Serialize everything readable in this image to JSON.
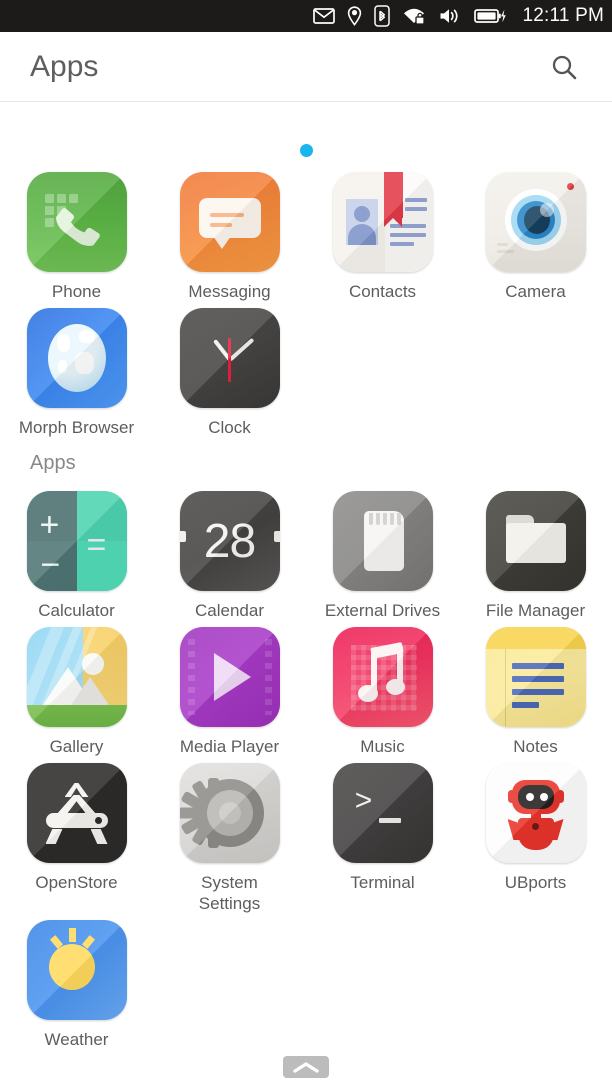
{
  "statusbar": {
    "time": "12:11 PM",
    "icons": [
      {
        "name": "message-icon",
        "label": "Messages"
      },
      {
        "name": "location-icon",
        "label": "Location"
      },
      {
        "name": "bluetooth-icon",
        "label": "Bluetooth"
      },
      {
        "name": "wifi-secure-icon",
        "label": "Wi-Fi secured"
      },
      {
        "name": "volume-icon",
        "label": "Sound"
      },
      {
        "name": "battery-charging-icon",
        "label": "Battery charging"
      }
    ],
    "background": "#1d1b19",
    "foreground": "#fdfdfd"
  },
  "header": {
    "title": "Apps",
    "search_icon": "search-icon"
  },
  "page_indicator": {
    "dots": 1,
    "active_index": 0,
    "color": "#19b6ee"
  },
  "sections": [
    {
      "title": "",
      "apps": [
        {
          "name": "Phone",
          "icon": "phone-icon"
        },
        {
          "name": "Messaging",
          "icon": "messaging-icon"
        },
        {
          "name": "Contacts",
          "icon": "contacts-icon"
        },
        {
          "name": "Camera",
          "icon": "camera-icon"
        },
        {
          "name": "Morph Browser",
          "icon": "morph-browser-icon"
        },
        {
          "name": "Clock",
          "icon": "clock-icon"
        }
      ]
    },
    {
      "title": "Apps",
      "apps": [
        {
          "name": "Calculator",
          "icon": "calculator-icon"
        },
        {
          "name": "Calendar",
          "icon": "calendar-icon"
        },
        {
          "name": "External Drives",
          "icon": "external-drives-icon"
        },
        {
          "name": "File Manager",
          "icon": "file-manager-icon"
        },
        {
          "name": "Gallery",
          "icon": "gallery-icon"
        },
        {
          "name": "Media Player",
          "icon": "media-player-icon"
        },
        {
          "name": "Music",
          "icon": "music-icon"
        },
        {
          "name": "Notes",
          "icon": "notes-icon"
        },
        {
          "name": "OpenStore",
          "icon": "openstore-icon"
        },
        {
          "name": "System Settings",
          "icon": "system-settings-icon"
        },
        {
          "name": "Terminal",
          "icon": "terminal-icon"
        },
        {
          "name": "UBports",
          "icon": "ubports-icon"
        },
        {
          "name": "Weather",
          "icon": "weather-icon"
        }
      ]
    }
  ],
  "calendar_icon_day": "28",
  "terminal_prompt": ">",
  "bottom_handle": {
    "icon": "chevron-up-icon",
    "color": "#bcbcbc"
  }
}
